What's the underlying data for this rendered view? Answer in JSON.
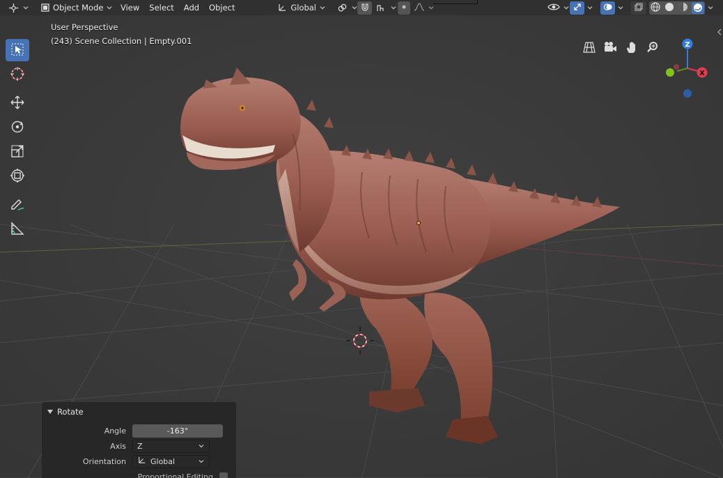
{
  "header": {
    "mode_label": "Object Mode",
    "menus": [
      "View",
      "Select",
      "Add",
      "Object"
    ],
    "transform_orientation": "Global"
  },
  "viewport": {
    "perspective_label": "User Perspective",
    "collection_label": "(243) Scene Collection | Empty.001"
  },
  "gizmo": {
    "z_label": "Z",
    "x_label": "X",
    "colors": {
      "x": "#e33c50",
      "y": "#82c21a",
      "z": "#2f7fe0",
      "neg_z": "#2d5fa6"
    }
  },
  "toolbar": {
    "tools": [
      "select-box",
      "cursor",
      "move",
      "rotate",
      "scale",
      "transform",
      "annotate",
      "measure"
    ],
    "active_tool": "select-box"
  },
  "operator_panel": {
    "title": "Rotate",
    "angle_label": "Angle",
    "angle_value": "-163°",
    "axis_label": "Axis",
    "axis_value": "Z",
    "orientation_label": "Orientation",
    "orientation_value": "Global",
    "proportional_label": "Proportional Editing",
    "proportional_checked": false
  },
  "colors": {
    "accent": "#4772b3",
    "background": "#3d3d3d",
    "header": "#303030"
  }
}
